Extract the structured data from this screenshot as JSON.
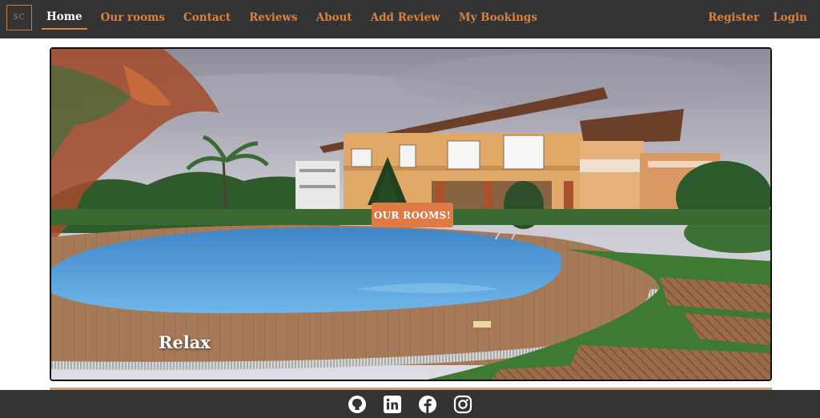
{
  "brand": {
    "logo_text": "SC"
  },
  "nav": {
    "links": [
      {
        "label": "Home",
        "active": true
      },
      {
        "label": "Our rooms"
      },
      {
        "label": "Contact"
      },
      {
        "label": "Reviews"
      },
      {
        "label": "About"
      },
      {
        "label": "Add Review"
      },
      {
        "label": "My Bookings"
      }
    ],
    "register": "Register",
    "login": "Login"
  },
  "hero": {
    "button_label": "OUR ROOMS!",
    "caption": "Relax"
  },
  "footer": {
    "icons": [
      "github-icon",
      "linkedin-icon",
      "facebook-icon",
      "instagram-icon"
    ]
  },
  "colors": {
    "accent": "#d9823f",
    "button": "#de7a45",
    "navbar": "#333333"
  }
}
